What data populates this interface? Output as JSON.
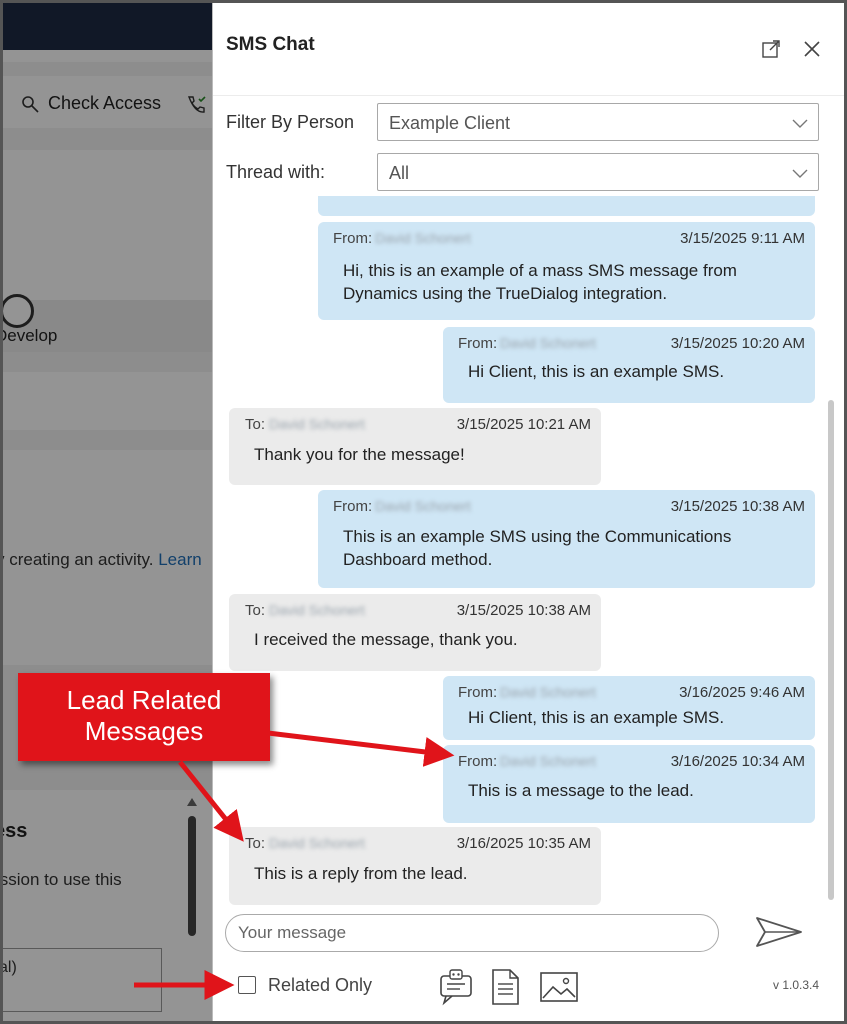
{
  "background_app": {
    "command": "Check Access",
    "stage_label": "Develop",
    "activity_text": "y creating an activity.",
    "activity_link": "Learn",
    "section_heading": "ess",
    "permission_text": "ission to use this",
    "field_value": "al)"
  },
  "panel": {
    "title": "SMS Chat",
    "filter_by_person": {
      "label": "Filter By Person",
      "value": "Example Client"
    },
    "thread_with": {
      "label": "Thread with:",
      "value": "All"
    },
    "messages": [
      {
        "direction": "out",
        "prefix": "From:",
        "name": "David Schonert",
        "time": "3/15/2025 9:11 AM",
        "text": [
          "Hi, this is an example of a mass SMS message from",
          "Dynamics using the TrueDialog integration."
        ]
      },
      {
        "direction": "out",
        "prefix": "From:",
        "name": "David Schonert",
        "time": "3/15/2025 10:20 AM",
        "text": [
          "Hi Client, this is an example SMS."
        ]
      },
      {
        "direction": "in",
        "prefix": "To:",
        "name": "David Schonert",
        "time": "3/15/2025 10:21 AM",
        "text": [
          "Thank you for the message!"
        ]
      },
      {
        "direction": "out",
        "prefix": "From:",
        "name": "David Schonert",
        "time": "3/15/2025 10:38 AM",
        "text": [
          "This is an example SMS using the Communications",
          "Dashboard method."
        ]
      },
      {
        "direction": "in",
        "prefix": "To:",
        "name": "David Schonert",
        "time": "3/15/2025 10:38 AM",
        "text": [
          "I received the message, thank you."
        ]
      },
      {
        "direction": "out",
        "prefix": "From:",
        "name": "David Schonert",
        "time": "3/16/2025 9:46 AM",
        "text": [
          "Hi Client, this is an example SMS."
        ]
      },
      {
        "direction": "out",
        "prefix": "From:",
        "name": "David Schonert",
        "time": "3/16/2025 10:34 AM",
        "text": [
          "This is a message to the lead."
        ]
      },
      {
        "direction": "in",
        "prefix": "To:",
        "name": "David Schonert",
        "time": "3/16/2025 10:35 AM",
        "text": [
          "This is a reply from the lead."
        ]
      }
    ],
    "compose_placeholder": "Your message",
    "related_only_label": "Related Only",
    "related_only_checked": false,
    "version": "v 1.0.3.4",
    "icons": [
      "expand-icon",
      "close-icon",
      "chevron-down-icon",
      "send-icon",
      "bot-chat-icon",
      "document-icon",
      "image-icon"
    ]
  },
  "annotation": {
    "callout_line1": "Lead Related",
    "callout_line2": "Messages",
    "color": "#e0141a"
  },
  "colors": {
    "outgoing_bubble": "#cfe6f5",
    "incoming_bubble": "#ebebeb",
    "link": "#1f6fb8"
  }
}
